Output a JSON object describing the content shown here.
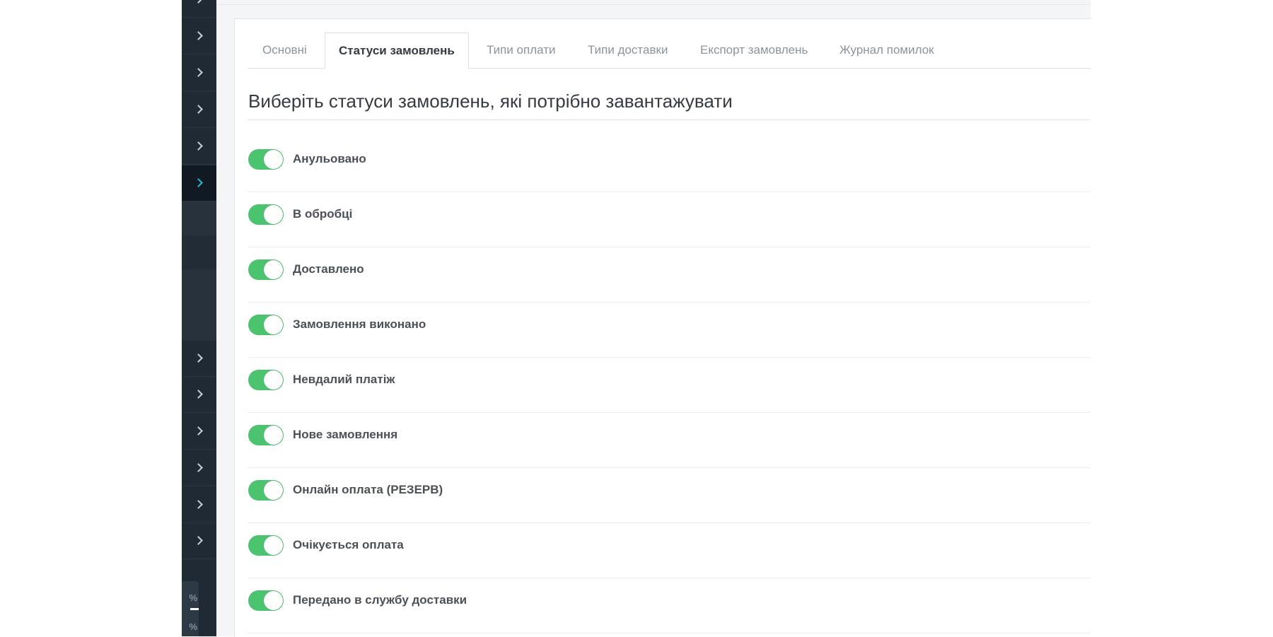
{
  "tabs": [
    {
      "label": "Основні",
      "active": false
    },
    {
      "label": "Статуси замовлень",
      "active": true
    },
    {
      "label": "Типи оплати",
      "active": false
    },
    {
      "label": "Типи доставки",
      "active": false
    },
    {
      "label": "Експорт замовлень",
      "active": false
    },
    {
      "label": "Журнал помилок",
      "active": false
    }
  ],
  "section": {
    "title": "Виберіть статуси замовлень, які потрібно завантажувати"
  },
  "statuses": [
    {
      "label": "Анульовано",
      "enabled": true
    },
    {
      "label": "В обробці",
      "enabled": true
    },
    {
      "label": "Доставлено",
      "enabled": true
    },
    {
      "label": "Замовлення виконано",
      "enabled": true
    },
    {
      "label": "Невдалий платіж",
      "enabled": true
    },
    {
      "label": "Нове замовлення",
      "enabled": true
    },
    {
      "label": "Онлайн оплата (РЕЗЕРВ)",
      "enabled": true
    },
    {
      "label": "Очікується оплата",
      "enabled": true
    },
    {
      "label": "Передано в службу доставки",
      "enabled": true
    }
  ],
  "sidebar_stats": {
    "value_1": "%",
    "value_2": "%"
  },
  "colors": {
    "toggle_on": "#4cc36e",
    "sidebar_bg": "#1f2a34",
    "sidebar_active_chevron": "#25b9d7",
    "heading_text": "#363a41"
  },
  "icons": {
    "sidebar_item": "chevron-right-icon"
  }
}
